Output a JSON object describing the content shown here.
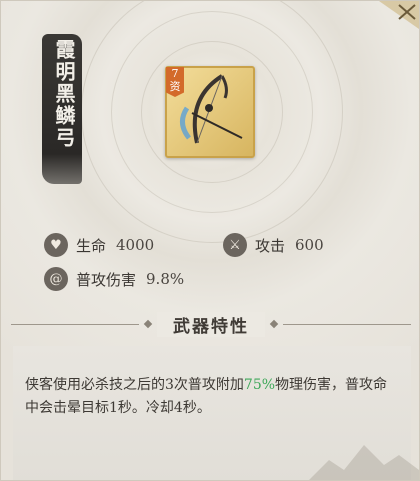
{
  "item": {
    "name": "霞明黑鳞弓",
    "grade_number": "7",
    "grade_char": "资"
  },
  "stats": {
    "hp_label": "生命",
    "hp_value": "4000",
    "atk_label": "攻击",
    "atk_value": "600",
    "normal_dmg_label": "普攻伤害",
    "normal_dmg_value": "9.8%"
  },
  "section": {
    "title": "武器特性"
  },
  "description": {
    "part1": "侠客使用必杀技之后的3次普攻附加",
    "highlight": "75%",
    "part2": "物理伤害，普攻命中会击晕目标1秒。冷却4秒。"
  },
  "colors": {
    "highlight": "#3fa85a",
    "card_border": "#c9a24a",
    "grade_badge": "#d36a2a"
  },
  "icons": {
    "hp": "heart-icon",
    "atk": "sword-icon",
    "normal_dmg": "swirl-icon",
    "close": "close-icon"
  }
}
